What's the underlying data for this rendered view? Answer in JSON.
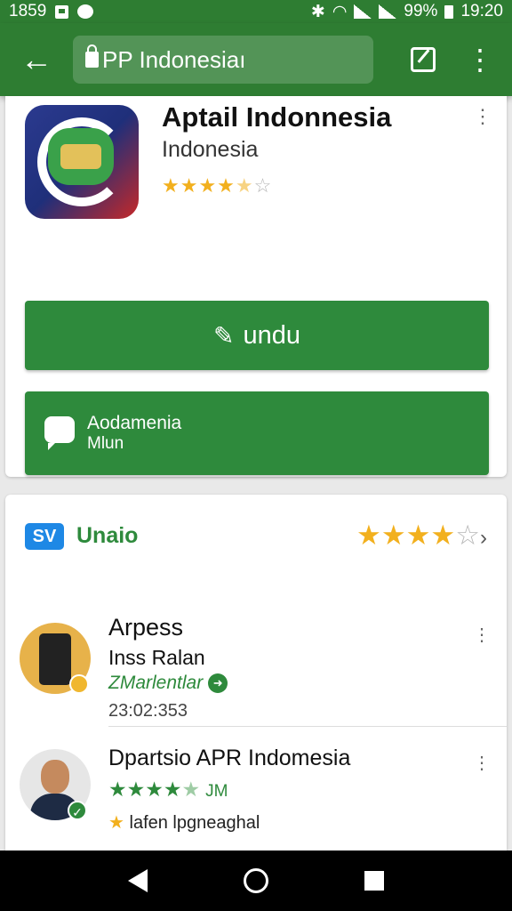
{
  "status_bar": {
    "time_left": "1859",
    "battery": "99%",
    "time_right": "19:20"
  },
  "toolbar": {
    "url": "PP Indonesiaı",
    "back_icon": "back-arrow-icon",
    "tab_icon": "tab-switch-icon",
    "menu_icon": "more-vertical-icon"
  },
  "app": {
    "title": "Aptail Indonnesia",
    "subtitle": "Indonesia",
    "rating_stars": "★★★★",
    "rating_half": "★",
    "rating_empty": "☆",
    "install_label": "undu",
    "secondary_line1": "Aodamenia",
    "secondary_line2": "Mlun"
  },
  "section": {
    "title": "Unaio",
    "icon_text": "SV",
    "stars_on": "★★★★",
    "stars_off": "☆",
    "chevron": "›"
  },
  "items": [
    {
      "title": "Arpess",
      "subtitle": "Inss Ralan",
      "tag": "ZMarlentlar",
      "time": "23:02:353"
    },
    {
      "title": "Dpartsio APR Indomesia",
      "stars_on": "★★★★",
      "stars_half": "★",
      "count": "JM",
      "footer_star": "★",
      "footer": "lafen lpgneaghal"
    }
  ],
  "colors": {
    "primary_green": "#2e7d32",
    "button_green": "#2e8a3c",
    "star_yellow": "#f2b01e"
  }
}
